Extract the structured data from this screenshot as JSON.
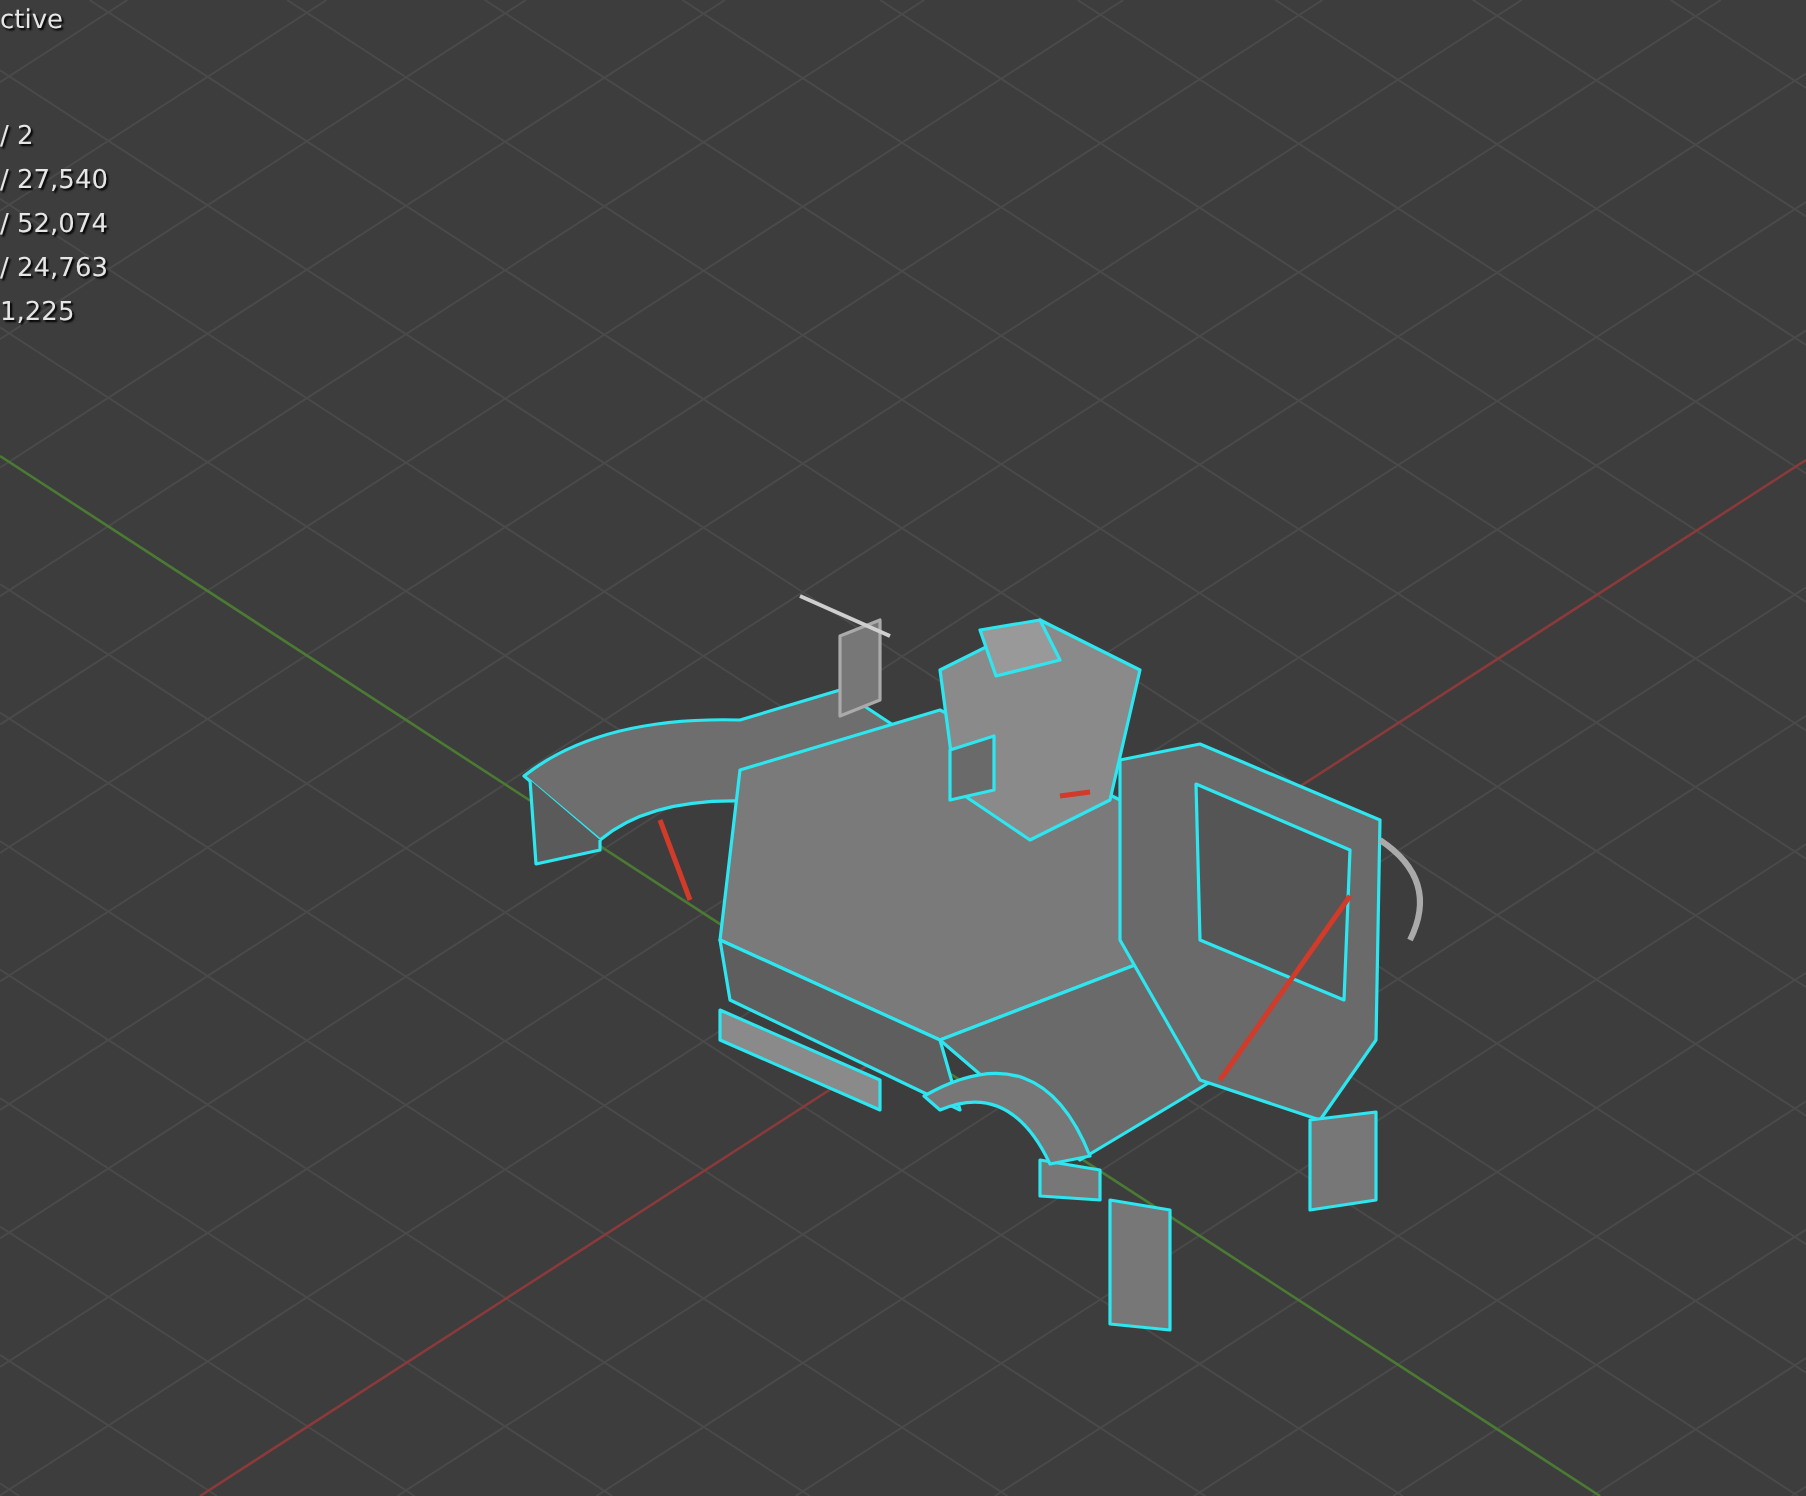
{
  "viewport_overlay": {
    "mode": "ctive",
    "stats": [
      {
        "value": "/ 2"
      },
      {
        "value": "/ 27,540"
      },
      {
        "value": "/ 52,074"
      },
      {
        "value": "/ 24,763"
      },
      {
        "value": "1,225"
      }
    ]
  }
}
